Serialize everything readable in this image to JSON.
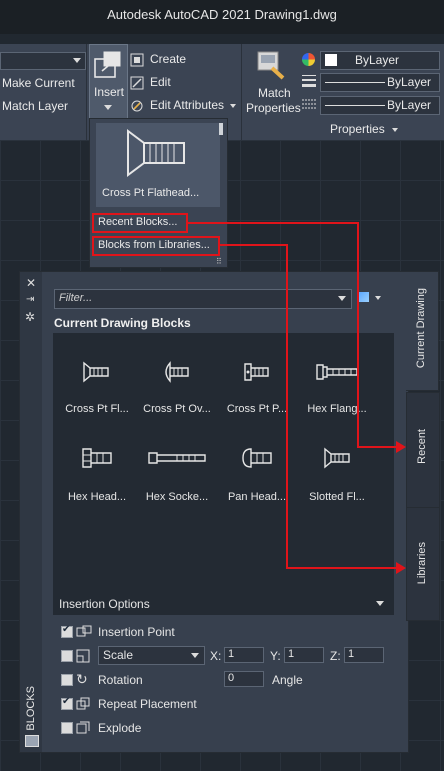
{
  "title_bar": {
    "text": "Autodesk AutoCAD 2021   Drawing1.dwg"
  },
  "ribbon": {
    "layer_actions": [
      "Make Current",
      "Match Layer"
    ],
    "insert_label": "Insert",
    "block_actions": [
      "Create",
      "Edit",
      "Edit Attributes"
    ],
    "match_properties_label": [
      "Match",
      "Properties"
    ],
    "property_values": [
      "ByLayer",
      "ByLayer",
      "ByLayer"
    ],
    "properties_panel_label": "Properties"
  },
  "insert_dropdown": {
    "preview_label": "Cross Pt Flathead...",
    "menu_items": [
      "Recent Blocks...",
      "Blocks from Libraries..."
    ]
  },
  "blocks_palette": {
    "palette_title": "BLOCKS",
    "filter_placeholder": "Filter...",
    "section_title": "Current Drawing Blocks",
    "blocks": [
      "Cross Pt Fl...",
      "Cross Pt Ov...",
      "Cross Pt P...",
      "Hex Flang...",
      "Hex Head...",
      "Hex Socke...",
      "Pan Head...",
      "Slotted Fl..."
    ],
    "tabs": [
      "Current Drawing",
      "Recent",
      "Libraries"
    ],
    "insertion_options": {
      "header": "Insertion Options",
      "insertion_point_label": "Insertion Point",
      "insertion_point_checked": true,
      "scale_label": "Scale",
      "x_label": "X:",
      "x_value": "1",
      "y_label": "Y:",
      "y_value": "1",
      "z_label": "Z:",
      "z_value": "1",
      "rotation_label": "Rotation",
      "rotation_value": "0",
      "angle_label": "Angle",
      "repeat_placement_label": "Repeat Placement",
      "repeat_placement_checked": true,
      "explode_label": "Explode",
      "explode_checked": false
    }
  },
  "colors": {
    "annotation_red": "#e0141a",
    "ribbon_bg": "#3b4453",
    "palette_bg": "#37404e",
    "content_bg": "#232a33"
  }
}
